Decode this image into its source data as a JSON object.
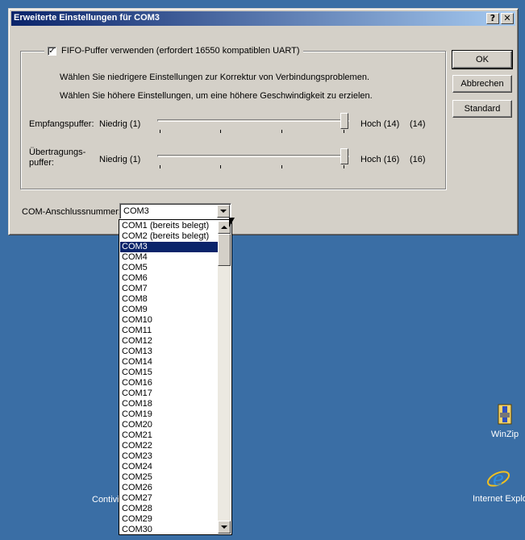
{
  "dialog": {
    "title": "Erweiterte Einstellungen für COM3",
    "help_button": "?",
    "close_button": "✕",
    "fifo": {
      "checked": true,
      "check_mark": "✓",
      "label": "FIFO-Puffer verwenden (erfordert 16550 kompatiblen UART)",
      "hint_low": "Wählen Sie niedrigere Einstellungen zur Korrektur von Verbindungsproblemen.",
      "hint_high": "Wählen Sie höhere Einstellungen, um eine höhere Geschwindigkeit zu erzielen."
    },
    "receive": {
      "label": "Empfangspuffer:",
      "min_label": "Niedrig (1)",
      "max_label": "Hoch (14)",
      "value": "(14)"
    },
    "transmit": {
      "label_line1": "Übertragungs-",
      "label_line2": "puffer:",
      "min_label": "Niedrig (1)",
      "max_label": "Hoch (16)",
      "value": "(16)"
    },
    "buttons": {
      "ok": "OK",
      "cancel": "Abbrechen",
      "default": "Standard"
    },
    "com_port": {
      "label": "COM-Anschlussnummer:",
      "value": "COM3",
      "options": [
        "COM1 (bereits belegt)",
        "COM2 (bereits belegt)",
        "COM3",
        "COM4",
        "COM5",
        "COM6",
        "COM7",
        "COM8",
        "COM9",
        "COM10",
        "COM11",
        "COM12",
        "COM13",
        "COM14",
        "COM15",
        "COM16",
        "COM17",
        "COM18",
        "COM19",
        "COM20",
        "COM21",
        "COM22",
        "COM23",
        "COM24",
        "COM25",
        "COM26",
        "COM27",
        "COM28",
        "COM29",
        "COM30"
      ],
      "selected_index": 2
    }
  },
  "desktop": {
    "icons": [
      {
        "label": "WinZip",
        "icon": "winzip-icon"
      },
      {
        "label": "Internet Explo",
        "icon": "internet-explorer-icon"
      },
      {
        "label": "Contivi",
        "icon": "partial-icon"
      }
    ]
  },
  "colors": {
    "desktop": "#3a6ea5",
    "title_start": "#0a246a",
    "title_end": "#a6caf0",
    "face": "#d4d0c8",
    "selection": "#0a246a"
  }
}
